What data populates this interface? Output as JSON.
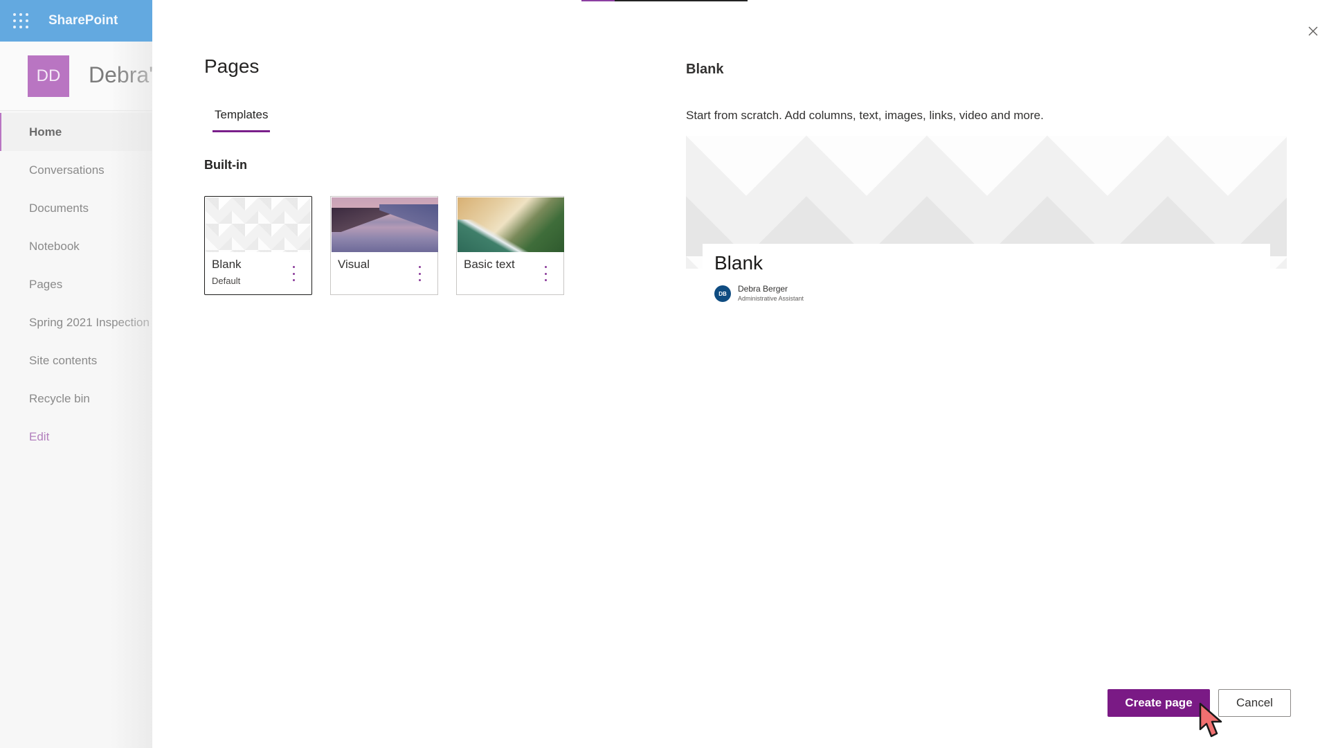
{
  "suite": {
    "app_name": "SharePoint",
    "waffle_icon": "app-launcher-icon"
  },
  "site": {
    "logo_initials": "DD",
    "logo_color": "#b975c2",
    "name": "Debra's",
    "nav": [
      {
        "label": "Home",
        "active": true
      },
      {
        "label": "Conversations"
      },
      {
        "label": "Documents"
      },
      {
        "label": "Notebook"
      },
      {
        "label": "Pages"
      },
      {
        "label": "Spring 2021 Inspection"
      },
      {
        "label": "Site contents"
      },
      {
        "label": "Recycle bin"
      }
    ],
    "edit_label": "Edit"
  },
  "panel": {
    "progress_fraction": 0.2,
    "close_icon": "close-icon",
    "title": "Pages",
    "tabs": [
      {
        "label": "Templates",
        "selected": true
      }
    ],
    "section_title": "Built-in",
    "templates": [
      {
        "name": "Blank",
        "subtitle": "Default",
        "selected": true,
        "thumbnail": "hexagon-pattern"
      },
      {
        "name": "Visual",
        "subtitle": "",
        "selected": false,
        "thumbnail": "lake-landscape"
      },
      {
        "name": "Basic text",
        "subtitle": "",
        "selected": false,
        "thumbnail": "beach-aerial"
      }
    ],
    "more_icon": "more-vertical-icon"
  },
  "preview": {
    "title": "Blank",
    "description": "Start from scratch. Add columns, text, images, links, video and more.",
    "page_title": "Blank",
    "author": {
      "initials": "DB",
      "name": "Debra Berger",
      "role": "Administrative Assistant",
      "avatar_color": "#0f4c81"
    }
  },
  "actions": {
    "create_label": "Create page",
    "cancel_label": "Cancel",
    "accent_color": "#7a1a85"
  }
}
